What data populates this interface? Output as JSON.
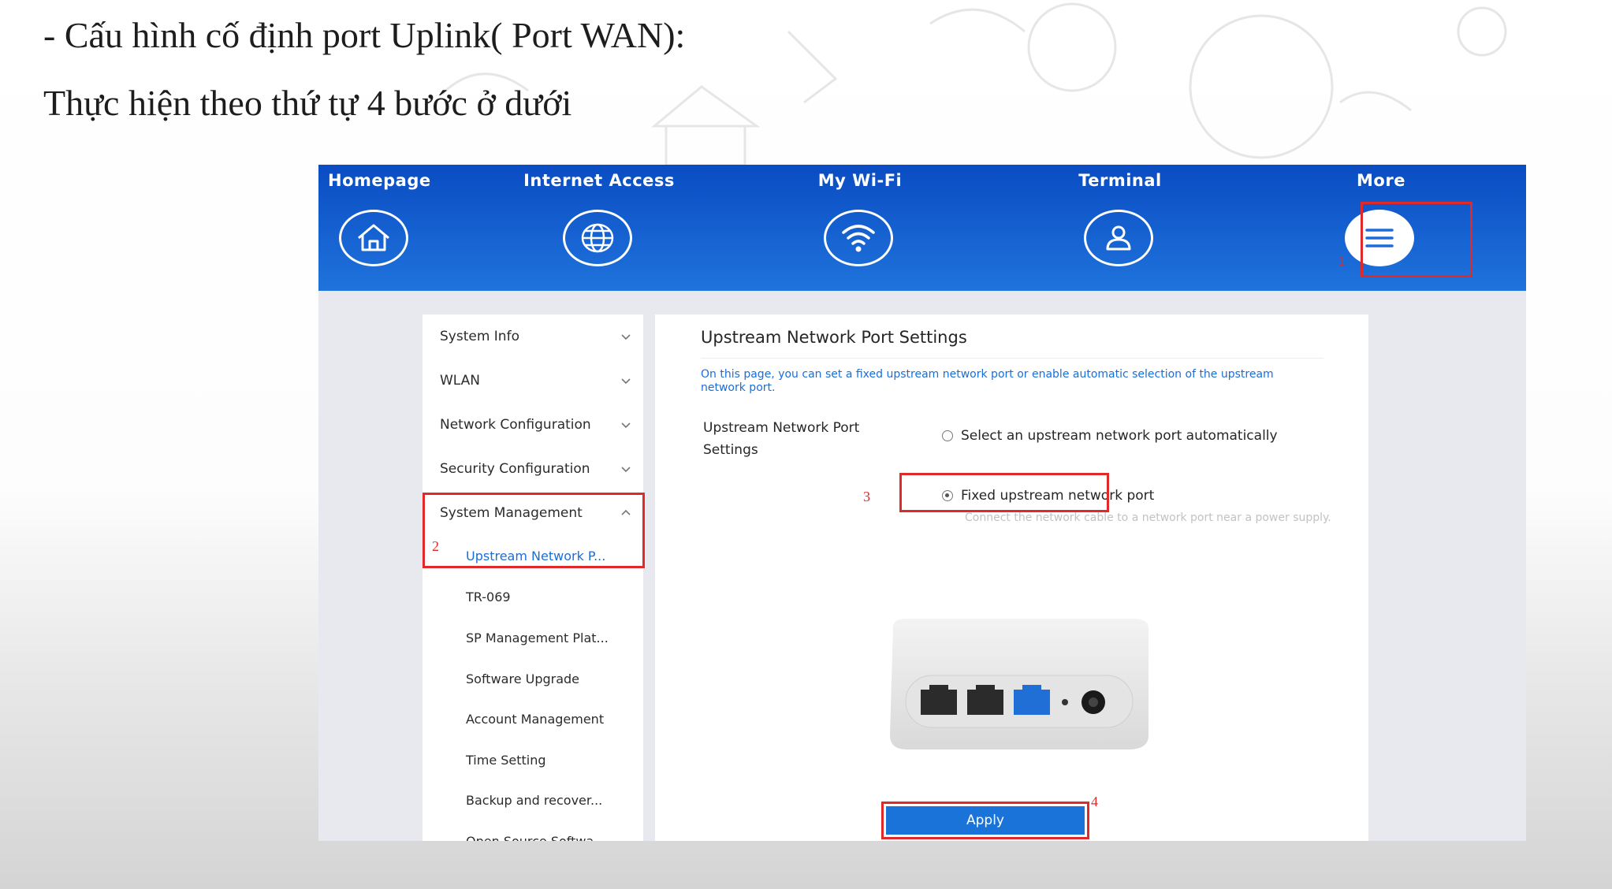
{
  "slide": {
    "line1": "- Cấu hình cố định port Uplink( Port WAN):",
    "line2": "Thực hiện theo thứ tự 4 bước ở dưới"
  },
  "nav": {
    "items": [
      {
        "label": "Homepage",
        "icon": "home-icon"
      },
      {
        "label": "Internet Access",
        "icon": "globe-icon"
      },
      {
        "label": "My Wi-Fi",
        "icon": "wifi-icon"
      },
      {
        "label": "Terminal",
        "icon": "user-icon"
      },
      {
        "label": "More",
        "icon": "menu-icon"
      }
    ]
  },
  "steps": {
    "s1": "1",
    "s2": "2",
    "s3": "3",
    "s4": "4"
  },
  "sidebar": {
    "items": [
      {
        "label": "System Info"
      },
      {
        "label": "WLAN"
      },
      {
        "label": "Network Configuration"
      },
      {
        "label": "Security Configuration"
      },
      {
        "label": "System Management"
      }
    ],
    "sub_items": [
      {
        "label": "Upstream Network P...",
        "active": true
      },
      {
        "label": "TR-069"
      },
      {
        "label": "SP Management Plat..."
      },
      {
        "label": "Software Upgrade"
      },
      {
        "label": "Account Management"
      },
      {
        "label": "Time Setting"
      },
      {
        "label": "Backup and recover..."
      },
      {
        "label": "Open Source Softwa..."
      }
    ]
  },
  "content": {
    "title": "Upstream Network Port Settings",
    "description": "On this page, you can set a fixed upstream network port or enable automatic selection of the upstream network port.",
    "field_label": "Upstream Network Port Settings",
    "option_auto": "Select an upstream network port automatically",
    "option_fixed": "Fixed upstream network port",
    "selected_option": "Fixed upstream network port",
    "note": "Connect the network cable to a network port near a power supply.",
    "apply_label": "Apply"
  },
  "colors": {
    "header_blue": "#0a4cc3",
    "accent_blue": "#1a73d9",
    "annotation_red": "#e02a2a"
  }
}
